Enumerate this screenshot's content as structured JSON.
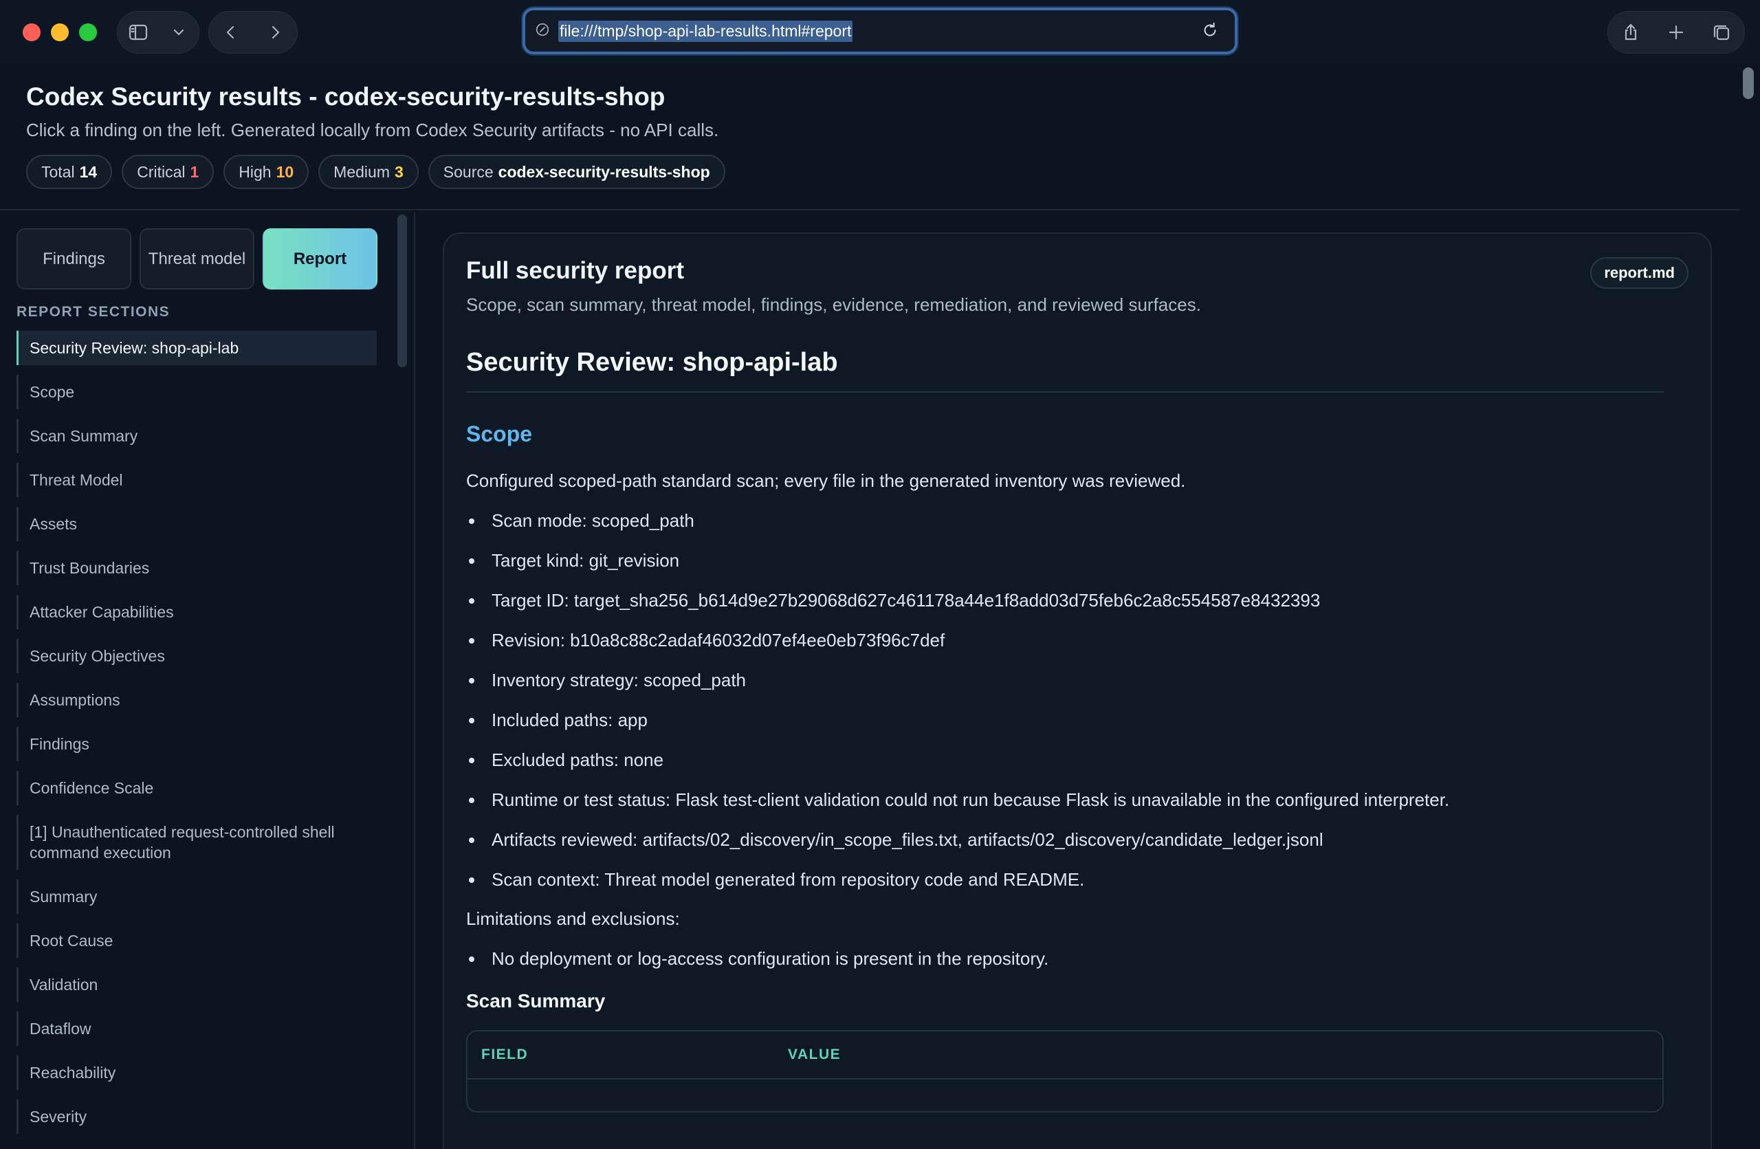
{
  "browser": {
    "url": "file:///tmp/shop-api-lab-results.html#report"
  },
  "header": {
    "title": "Codex Security results - codex-security-results-shop",
    "subtitle": "Click a finding on the left. Generated locally from Codex Security artifacts - no API calls.",
    "badges": {
      "total_label": "Total",
      "total_value": "14",
      "critical_label": "Critical",
      "critical_value": "1",
      "high_label": "High",
      "high_value": "10",
      "medium_label": "Medium",
      "medium_value": "3",
      "source_label": "Source",
      "source_value": "codex-security-results-shop"
    },
    "badge_colors": {
      "critical": "#ff6b6b",
      "high": "#ffb24a",
      "medium": "#ffd84a"
    }
  },
  "tabs": {
    "findings": "Findings",
    "threat_model": "Threat model",
    "report": "Report",
    "active": "report"
  },
  "sidebar": {
    "heading": "REPORT SECTIONS",
    "items": [
      "Security Review: shop-api-lab",
      "Scope",
      "Scan Summary",
      "Threat Model",
      "Assets",
      "Trust Boundaries",
      "Attacker Capabilities",
      "Security Objectives",
      "Assumptions",
      "Findings",
      "Confidence Scale",
      "[1] Unauthenticated request-controlled shell command execution",
      "Summary",
      "Root Cause",
      "Validation",
      "Dataflow",
      "Reachability",
      "Severity"
    ]
  },
  "report": {
    "title": "Full security report",
    "description": "Scope, scan summary, threat model, findings, evidence, remediation, and reviewed surfaces.",
    "file_badge": "report.md",
    "h1": "Security Review: shop-api-lab",
    "scope_heading": "Scope",
    "scope_intro": "Configured scoped-path standard scan; every file in the generated inventory was reviewed.",
    "scope_items": [
      "Scan mode: scoped_path",
      "Target kind: git_revision",
      "Target ID: target_sha256_b614d9e27b29068d627c461178a44e1f8add03d75feb6c2a8c554587e8432393",
      "Revision: b10a8c88c2adaf46032d07ef4ee0eb73f96c7def",
      "Inventory strategy: scoped_path",
      "Included paths: app",
      "Excluded paths: none",
      "Runtime or test status: Flask test-client validation could not run because Flask is unavailable in the configured interpreter.",
      "Artifacts reviewed: artifacts/02_discovery/in_scope_files.txt, artifacts/02_discovery/candidate_ledger.jsonl",
      "Scan context: Threat model generated from repository code and README."
    ],
    "limitations_label": "Limitations and exclusions:",
    "limitations_items": [
      "No deployment or log-access configuration is present in the repository."
    ],
    "scan_summary_heading": "Scan Summary",
    "table_headers": {
      "field": "FIELD",
      "value": "VALUE"
    }
  }
}
